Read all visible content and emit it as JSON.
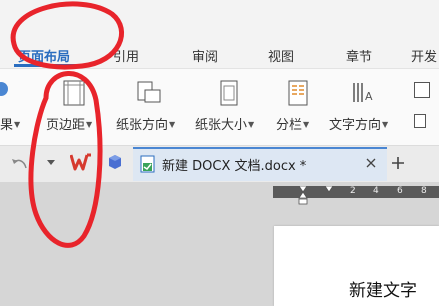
{
  "tabs": [
    {
      "label": "页面布局",
      "active": true
    },
    {
      "label": "引用"
    },
    {
      "label": "审阅"
    },
    {
      "label": "视图"
    },
    {
      "label": "章节"
    },
    {
      "label": "开发"
    }
  ],
  "ribbon": {
    "partial_left": "果",
    "margins": "页边距",
    "orientation": "纸张方向",
    "paper_size": "纸张大小",
    "columns": "分栏",
    "text_direction": "文字方向"
  },
  "doc_tab": {
    "title": "新建 DOCX 文档.docx *"
  },
  "ruler": {
    "marks": [
      "2",
      "4",
      "6",
      "8"
    ]
  },
  "document": {
    "visible_text": "新建文字"
  },
  "colors": {
    "accent": "#2a6dbf",
    "annotation": "#e8242b",
    "wps_red": "#d63a2f"
  }
}
